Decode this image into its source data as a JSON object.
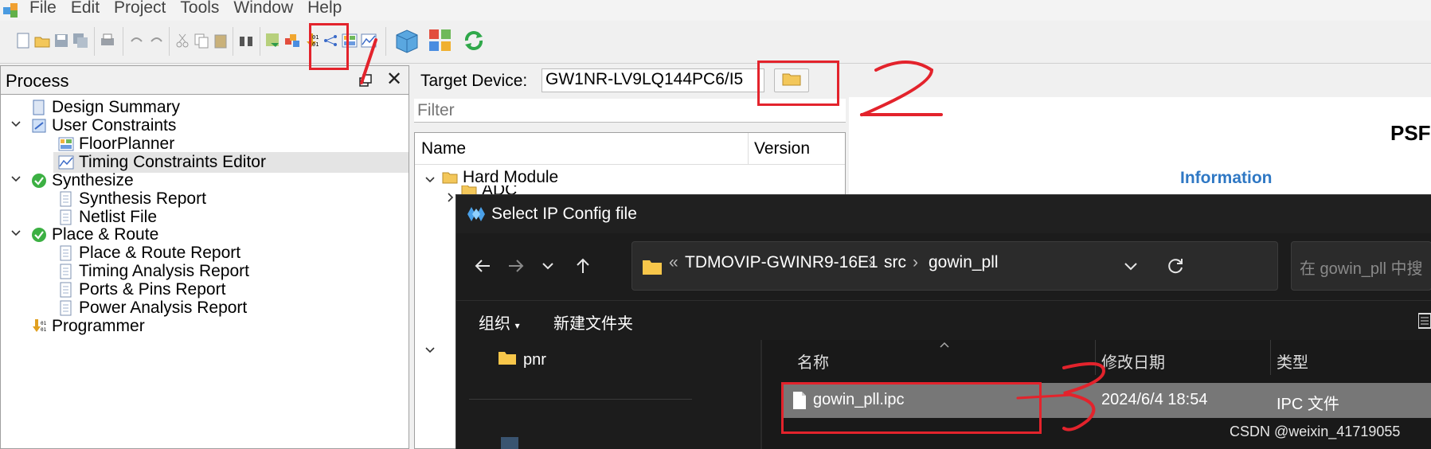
{
  "menu": [
    "File",
    "Edit",
    "Project",
    "Tools",
    "Window",
    "Help"
  ],
  "process": {
    "title": "Process",
    "items": [
      {
        "label": "Design Summary",
        "icon": "document-icon"
      },
      {
        "label": "User Constraints",
        "icon": "constraints-icon"
      },
      {
        "label": "FloorPlanner",
        "icon": "floorplanner-icon"
      },
      {
        "label": "Timing Constraints Editor",
        "icon": "timing-editor-icon"
      },
      {
        "label": "Synthesize",
        "icon": "check-circle-icon"
      },
      {
        "label": "Synthesis Report",
        "icon": "document-icon"
      },
      {
        "label": "Netlist File",
        "icon": "document-icon"
      },
      {
        "label": "Place & Route",
        "icon": "check-circle-icon"
      },
      {
        "label": "Place & Route Report",
        "icon": "document-icon"
      },
      {
        "label": "Timing Analysis Report",
        "icon": "document-icon"
      },
      {
        "label": "Ports & Pins Report",
        "icon": "document-icon"
      },
      {
        "label": "Power Analysis Report",
        "icon": "document-icon"
      },
      {
        "label": "Programmer",
        "icon": "programmer-icon"
      }
    ]
  },
  "target": {
    "label": "Target Device:",
    "value": "GW1NR-LV9LQ144PC6/I5"
  },
  "filter": {
    "placeholder": "Filter"
  },
  "ip_tree": {
    "columns": [
      "Name",
      "Version"
    ],
    "rows": [
      "Hard Module",
      "ADC"
    ]
  },
  "info": {
    "title_partial": "PSF",
    "section": "Information"
  },
  "dialog": {
    "title": "Select IP Config file",
    "breadcrumb": [
      "TDMOVIP-GWINR9-16E1",
      "src",
      "gowin_pll"
    ],
    "breadcrumb_overflow": "«",
    "search_placeholder": "在 gowin_pll 中搜",
    "commands": {
      "organize": "组织",
      "new_folder": "新建文件夹"
    },
    "sidebar_items": [
      "pnr"
    ],
    "columns": [
      "名称",
      "修改日期",
      "类型"
    ],
    "files": [
      {
        "name": "gowin_pll.ipc",
        "date": "2024/6/4 18:54",
        "type": "IPC 文件"
      }
    ]
  },
  "annotations": [
    "1",
    "2",
    "3"
  ],
  "watermark": "CSDN @weixin_41719055",
  "colors": {
    "accent": "#e3232c",
    "info_blue": "#2f78c4",
    "dialog_bg": "#1c1c1c",
    "selected_file": "#777777"
  }
}
